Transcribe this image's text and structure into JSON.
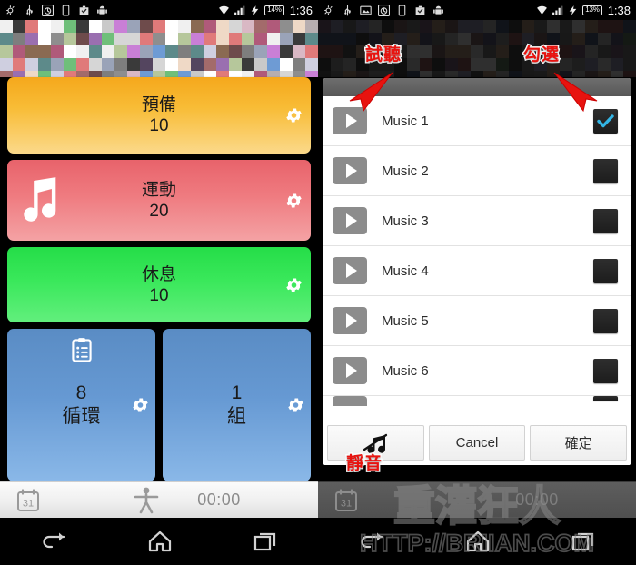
{
  "left_screen": {
    "statusbar": {
      "icons": [
        "weather-icon",
        "usb-icon",
        "alarm-icon",
        "sim-icon",
        "task-icon",
        "android-icon"
      ],
      "signal_icons": [
        "wifi-icon",
        "cellular-icon",
        "charging-bolt-icon"
      ],
      "battery": "14%",
      "time": "1:36"
    },
    "cards": [
      {
        "name": "prepare",
        "title": "預備",
        "value": "10",
        "color": "#f8bc36",
        "gear": "gear-icon"
      },
      {
        "name": "exercise",
        "title": "運動",
        "value": "20",
        "color": "#ef7b80",
        "gear": "gear-icon",
        "icon": "music-note-icon"
      },
      {
        "name": "rest",
        "title": "休息",
        "value": "10",
        "color": "#3ae85b",
        "gear": "gear-icon"
      }
    ],
    "blue_cards": [
      {
        "name": "cycles",
        "value": "8",
        "title": "循環",
        "color": "#6699d3",
        "gear": "gear-icon",
        "icon": "clipboard-icon"
      },
      {
        "name": "sets",
        "value": "1",
        "title": "組",
        "color": "#6699d3",
        "gear": "gear-icon"
      }
    ],
    "actionbar": {
      "calendar_icon": "calendar-31-icon",
      "calendar_day": "31",
      "exercise_icon": "person-exercise-icon",
      "timer": "00:00"
    },
    "navbar": {
      "back": "back-icon",
      "home": "home-icon",
      "recents": "recents-icon"
    }
  },
  "right_screen": {
    "statusbar": {
      "icons": [
        "weather-icon",
        "usb-icon",
        "image-icon",
        "alarm-icon",
        "sim-icon",
        "task-icon",
        "android-icon"
      ],
      "signal_icons": [
        "wifi-icon",
        "cellular-icon",
        "charging-bolt-icon"
      ],
      "battery": "13%",
      "time": "1:38"
    },
    "dialog": {
      "rows": [
        {
          "label": "Music 1",
          "checked": true
        },
        {
          "label": "Music 2",
          "checked": false
        },
        {
          "label": "Music 3",
          "checked": false
        },
        {
          "label": "Music 4",
          "checked": false
        },
        {
          "label": "Music 5",
          "checked": false
        },
        {
          "label": "Music 6",
          "checked": false
        }
      ],
      "play_icon": "play-icon",
      "check_color": "#33b5e5",
      "buttons": [
        {
          "name": "mute",
          "label": "",
          "icon": "music-note-muted-icon"
        },
        {
          "name": "cancel",
          "label": "Cancel"
        },
        {
          "name": "confirm",
          "label": "確定"
        }
      ]
    },
    "annotations": [
      {
        "name": "preview",
        "text": "試聽"
      },
      {
        "name": "select",
        "text": "勾選"
      },
      {
        "name": "mute",
        "text": "靜音"
      }
    ],
    "actionbar": {
      "calendar_icon": "calendar-31-icon",
      "calendar_day": "31",
      "timer": "00:00"
    },
    "navbar": {
      "back": "back-icon",
      "home": "home-icon",
      "recents": "recents-icon"
    },
    "watermark": {
      "line1": "重灌狂人",
      "line2": "HTTP://BRIIAN.COM"
    }
  }
}
